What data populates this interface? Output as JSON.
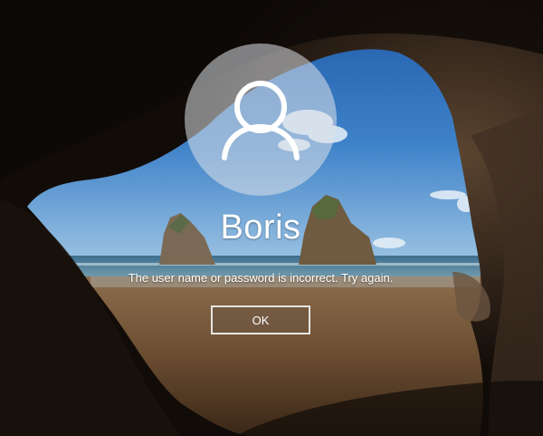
{
  "user": {
    "name": "Boris"
  },
  "message": {
    "text": "The user name or password is incorrect. Try again."
  },
  "actions": {
    "ok_label": "OK"
  },
  "icons": {
    "avatar": "user-silhouette-icon"
  },
  "colors": {
    "avatar_circle": "#dee2e8",
    "text": "#ffffff",
    "button_border": "#e9e4df"
  }
}
